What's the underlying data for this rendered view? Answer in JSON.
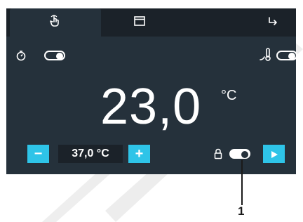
{
  "tabs": [
    {
      "icon": "touch-hand-icon",
      "active": true
    },
    {
      "icon": "window-icon",
      "active": false
    },
    {
      "icon": "return-arrow-icon",
      "active": false
    }
  ],
  "top_controls": {
    "timer_icon": "timer-icon",
    "timer_toggle": "off",
    "probe_icon": "probe-thermometer-icon",
    "probe_toggle": "off"
  },
  "display": {
    "temperature": "23,0",
    "unit": "°C"
  },
  "bottom_controls": {
    "minus_label": "−",
    "setpoint": "37,0 °C",
    "plus_label": "+",
    "lock_icon": "lock-icon",
    "lock_toggle": "on",
    "play_icon": "play-icon"
  },
  "annotation": {
    "label": "1"
  },
  "colors": {
    "screen_bg": "#25313b",
    "tabbar_bg": "#1b2229",
    "accent": "#2ec4e8",
    "text": "#ffffff"
  }
}
